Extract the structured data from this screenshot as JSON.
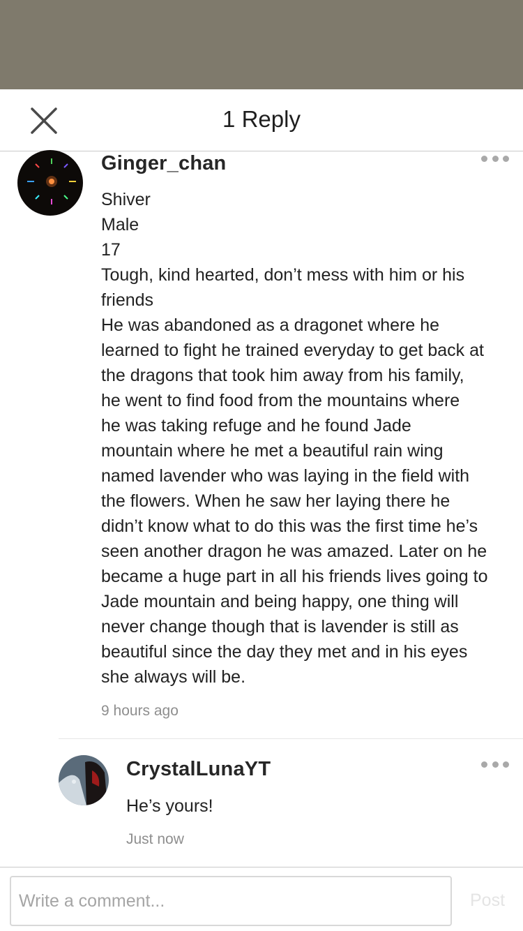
{
  "header": {
    "title": "1 Reply",
    "close_icon": "close-icon"
  },
  "comment": {
    "username": "Ginger_chan",
    "lines": [
      "Shiver",
      "Male",
      "17",
      "Tough, kind hearted, don’t mess with him or his",
      "friends",
      "He was abandoned as a dragonet where he",
      "learned to fight he trained everyday to get back at",
      "the dragons that took him away from his family,",
      "he went to find food from the mountains where",
      "he was taking refuge and he found Jade",
      "mountain where he met a beautiful rain wing",
      "named lavender who was laying in the field with",
      "the flowers. When he saw her laying there he",
      "didn’t know what to do this was the first time he’s",
      "seen another dragon he was amazed. Later on he",
      "became a huge part in all his friends lives going to",
      "Jade mountain and being happy, one thing will",
      "never change though  that is lavender is still as",
      "beautiful since the day they met and in his eyes",
      "she always will be."
    ],
    "time": "9 hours ago"
  },
  "reply": {
    "username": "CrystalLunaYT",
    "text": "He’s yours!",
    "time": "Just now"
  },
  "composer": {
    "placeholder": "Write a comment...",
    "value": "",
    "post_label": "Post"
  },
  "colors": {
    "overlay": "#7f7a6c",
    "divider": "#c9c9c9",
    "muted_text": "#8e8e8e",
    "post_disabled": "#e4e4e4"
  }
}
